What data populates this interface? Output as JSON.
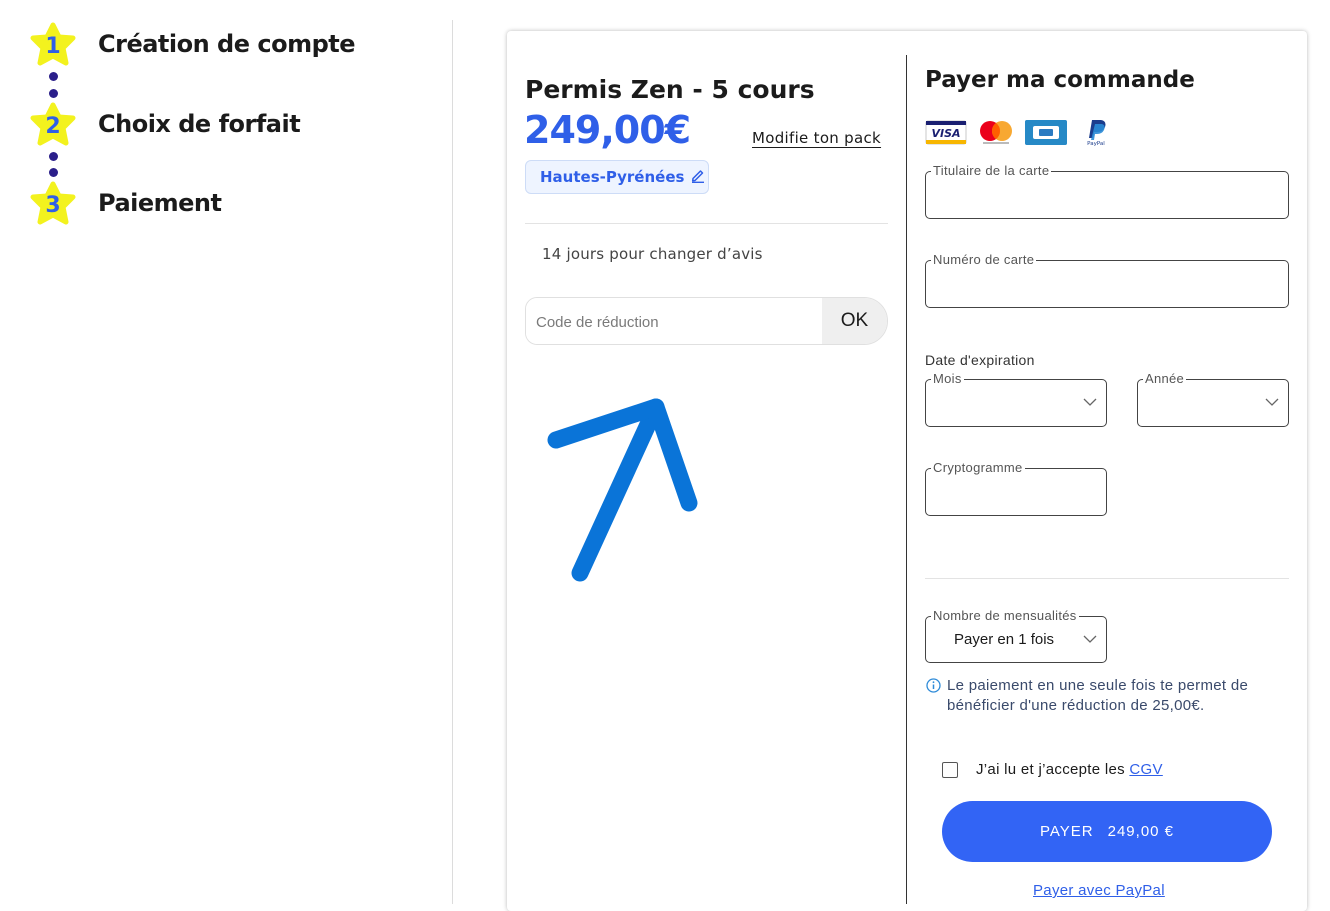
{
  "steps": [
    {
      "number": "1",
      "label": "Création de compte"
    },
    {
      "number": "2",
      "label": "Choix de forfait"
    },
    {
      "number": "3",
      "label": "Paiement"
    }
  ],
  "product": {
    "title": "Permis Zen - 5 cours",
    "price": "249,00€",
    "modify_link": "Modifie ton pack",
    "region": "Hautes-Pyrénées",
    "withdrawal_text": "14 jours pour changer d’avis"
  },
  "promo": {
    "placeholder": "Code de réduction",
    "button_label": "OK"
  },
  "payment": {
    "title": "Payer ma commande",
    "card_logos": [
      "visa-logo",
      "mastercard-logo",
      "cb-logo",
      "paypal-logo"
    ],
    "cardholder_label": "Titulaire de la carte",
    "card_number_label": "Numéro de carte",
    "expiry_label": "Date d'expiration",
    "month_label": "Mois",
    "year_label": "Année",
    "cvv_label": "Cryptogramme",
    "installments_label": "Nombre de mensualités",
    "installments_value": "Payer en 1 fois",
    "info_text": "Le paiement en une seule fois te permet de bénéficier d'une réduction de 25,00€.",
    "cgv_text": "J’ai lu et j’accepte les ",
    "cgv_link": "CGV",
    "pay_button_label": "PAYER",
    "pay_button_amount": "249,00 €",
    "paypal_link": "Payer avec PayPal"
  },
  "colors": {
    "accent": "#3264f5",
    "star": "#f3f21e",
    "annotation_arrow": "#0a74d8"
  }
}
